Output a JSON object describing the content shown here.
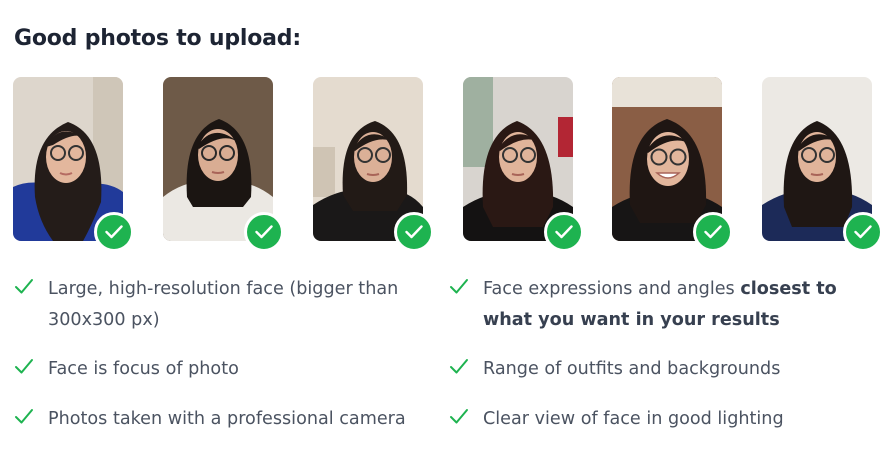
{
  "heading": "Good photos to upload:",
  "photos": [
    {
      "icon": "check-icon"
    },
    {
      "icon": "check-icon"
    },
    {
      "icon": "check-icon"
    },
    {
      "icon": "check-icon"
    },
    {
      "icon": "check-icon"
    },
    {
      "icon": "check-icon"
    }
  ],
  "criteria_left": [
    {
      "line1": "Large, high-resolution face (bigger than",
      "line2": "300x300 px)"
    },
    {
      "text": "Face is focus of photo"
    },
    {
      "text": "Photos taken with a professional camera"
    }
  ],
  "criteria_right": [
    {
      "prefix": "Face expressions and angles ",
      "bold1": "closest to",
      "bold2": "what you want in your results"
    },
    {
      "text": "Range of outfits and backgrounds"
    },
    {
      "text": "Clear view of face in good lighting"
    }
  ],
  "colors": {
    "accent": "#1eb350",
    "heading": "#1d2433",
    "body_text": "#4b5361"
  }
}
